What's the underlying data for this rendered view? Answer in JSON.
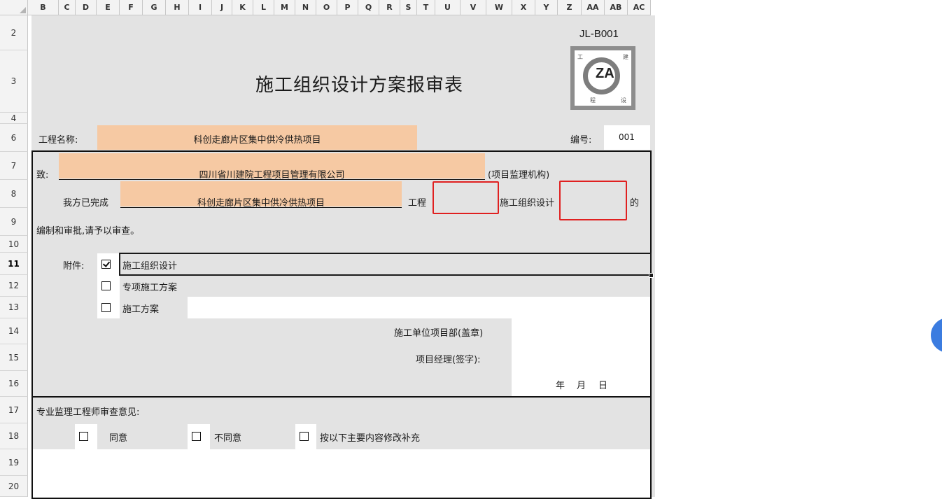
{
  "columns": [
    "B",
    "C",
    "D",
    "E",
    "F",
    "G",
    "H",
    "I",
    "J",
    "K",
    "L",
    "M",
    "N",
    "O",
    "P",
    "Q",
    "R",
    "S",
    "T",
    "U",
    "V",
    "W",
    "X",
    "Y",
    "Z",
    "AA",
    "AB",
    "AC"
  ],
  "rows": [
    "2",
    "3",
    "4",
    "6",
    "7",
    "8",
    "9",
    "10",
    "11",
    "12",
    "13",
    "14",
    "15",
    "16",
    "17",
    "18",
    "19",
    "20"
  ],
  "form": {
    "code": "JL-B001",
    "title": "施工组织设计方案报审表",
    "project_name_label": "工程名称:",
    "project_name_value": "科创走廊片区集中供冷供热项目",
    "number_label": "编号:",
    "number_value": "001",
    "to_label": "致:",
    "to_value": "四川省川建院工程项目管理有限公司",
    "to_suffix": "(项目监理机构)",
    "completed_label": "我方已完成",
    "completed_value": "科创走廊片区集中供冷供热项目",
    "engineering_label": "工程",
    "design_label": "施工组织设计",
    "of_label": "的",
    "approval_text": "编制和审批,请予以审查。",
    "attachment_label": "附件:",
    "attachments": [
      {
        "label": "施工组织设计",
        "checked": true
      },
      {
        "label": "专项施工方案",
        "checked": false
      },
      {
        "label": "施工方案",
        "checked": false
      }
    ],
    "contractor_dept": "施工单位项目部(盖章)",
    "pm_sign": "项目经理(签字):",
    "date_year": "年",
    "date_month": "月",
    "date_day": "日",
    "review_label": "专业监理工程师审查意见:",
    "options": [
      {
        "label": "同意"
      },
      {
        "label": "不同意"
      },
      {
        "label": "按以下主要内容修改补充"
      }
    ]
  },
  "logo": {
    "text": "ZA",
    "corner_chars": [
      "工",
      "建",
      "程",
      "设"
    ]
  }
}
